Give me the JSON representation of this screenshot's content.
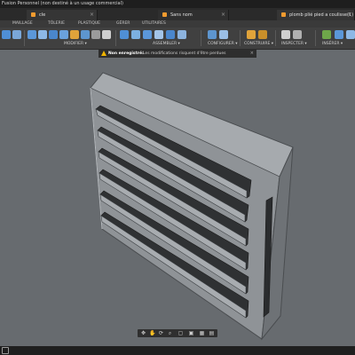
{
  "app": {
    "title": "Fusion Personnel (non destiné à un usage commercial)"
  },
  "doc_tabs": [
    {
      "label": "cle",
      "close": "×"
    },
    {
      "label": "Sans nom",
      "close": "×"
    },
    {
      "label": "plomb plié pied a coulisse(1)",
      "close": "×"
    }
  ],
  "workspace_tabs": [
    "MAILLAGE",
    "TÔLERIE",
    "PLASTIQUE",
    "GÉRER",
    "UTILITAIRES"
  ],
  "toolbar": {
    "groups": [
      "MODIFIER ▾",
      "ASSEMBLER ▾",
      "CONFIGURER ▾",
      "CONSTRUIRE ▾",
      "INSPECTER ▾",
      "INSÉRER ▾"
    ]
  },
  "notice": {
    "heading": "Non enregistré:",
    "message": "Les modifications risquent d'être perdues",
    "close": "×"
  },
  "navbar": {
    "icons": [
      "move-icon",
      "pan-icon",
      "orbit-icon",
      "zoom-icon",
      "fit-icon",
      "display-icon",
      "grid-icon",
      "viewports-icon"
    ]
  },
  "colors": {
    "title_bar": "#1e1e1e",
    "toolbar": "#404040",
    "viewport": "#676b6f",
    "model_face": "#8f9397",
    "warning": "#f0b400"
  }
}
